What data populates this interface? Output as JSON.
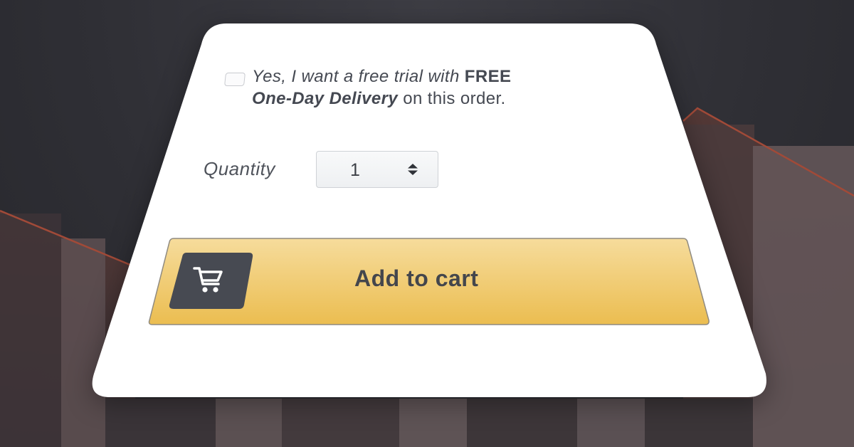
{
  "offer": {
    "checked": false,
    "line1_prefix": "Yes, I want a free trial with ",
    "line1_bold": "FREE",
    "line2_bold": "One-Day Delivery",
    "line2_suffix": " on this order."
  },
  "quantity": {
    "label": "Quantity",
    "value": "1"
  },
  "add_to_cart": {
    "label": "Add to cart",
    "icon": "shopping-cart-icon"
  },
  "colors": {
    "button_top": "#f6dc9c",
    "button_bottom": "#ebbd50",
    "icon_tile": "#474a52",
    "text": "#454952",
    "background": "#2f2f35",
    "chart_line": "#a14a38"
  }
}
